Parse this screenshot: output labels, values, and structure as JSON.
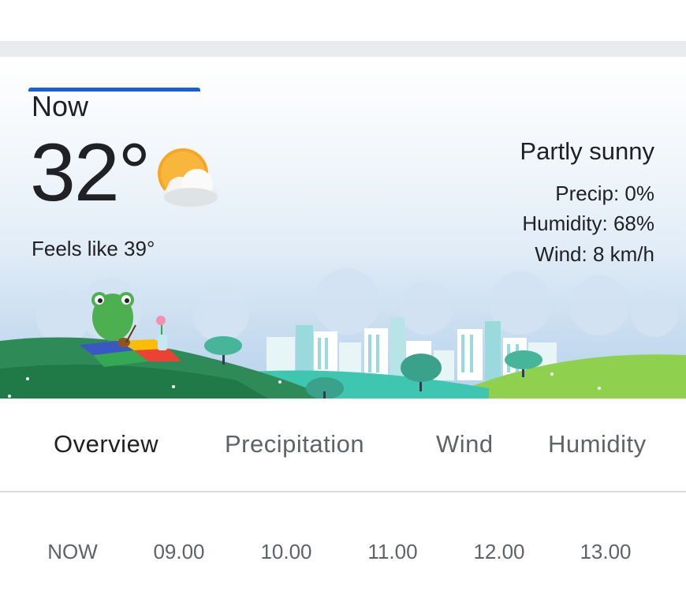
{
  "current": {
    "label": "Now",
    "temperature": "32°",
    "feels_like": "Feels like 39°",
    "condition": "Partly sunny",
    "precip": "Precip: 0%",
    "humidity": "Humidity: 68%",
    "wind": "Wind: 8 km/h",
    "icon": "partly-sunny-icon"
  },
  "tabs": [
    {
      "label": "Overview",
      "active": true
    },
    {
      "label": "Precipitation",
      "active": false
    },
    {
      "label": "Wind",
      "active": false
    },
    {
      "label": "Humidity",
      "active": false
    }
  ],
  "hours": [
    "NOW",
    "09.00",
    "10.00",
    "11.00",
    "12.00",
    "13.00"
  ],
  "colors": {
    "accent": "#1a5fd6",
    "sun": "#f6a623",
    "grass": "#2e8b57"
  }
}
